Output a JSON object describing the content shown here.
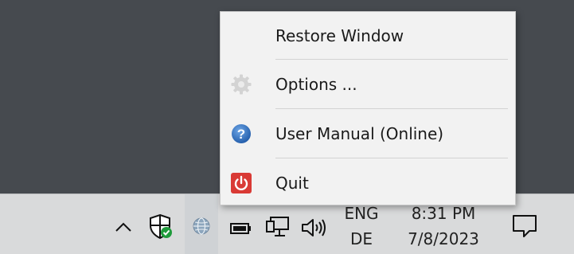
{
  "menu": {
    "items": [
      {
        "label": "Restore Window",
        "icon": null
      },
      {
        "label": "Options ...",
        "icon": "gear-icon"
      },
      {
        "label": "User Manual (Online)",
        "icon": "help-icon"
      },
      {
        "label": "Quit",
        "icon": "power-icon"
      }
    ]
  },
  "tray": {
    "language": "ENG",
    "keyboard_layout": "DE",
    "time": "8:31 PM",
    "date": "7/8/2023",
    "icons": [
      "chevron-up-icon",
      "security-shield-icon",
      "globe-app-icon",
      "battery-icon",
      "network-icon",
      "volume-icon",
      "notification-icon"
    ]
  },
  "colors": {
    "desktop": "#464a4f",
    "taskbar": "#d9dadb",
    "menu_bg": "#f2f2f2",
    "help_icon": "#2f6fc3",
    "power_icon": "#d93a35",
    "shield_check": "#1e9b3b"
  }
}
